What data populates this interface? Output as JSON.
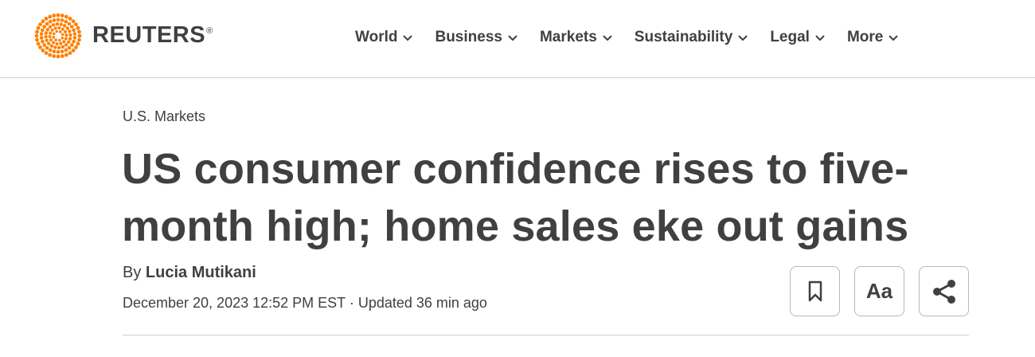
{
  "brand": {
    "name": "REUTERS",
    "registered": "®",
    "accent_color": "#ff8000"
  },
  "nav": {
    "items": [
      {
        "label": "World"
      },
      {
        "label": "Business"
      },
      {
        "label": "Markets"
      },
      {
        "label": "Sustainability"
      },
      {
        "label": "Legal"
      },
      {
        "label": "More"
      }
    ]
  },
  "article": {
    "category": "U.S. Markets",
    "headline_line1": "US consumer confidence rises to five-",
    "headline_line2": "month high; home sales eke out gains",
    "by_prefix": "By",
    "author": "Lucia Mutikani",
    "dateline": "December 20, 2023 12:52 PM EST · Updated 36 min ago"
  },
  "tools": {
    "bookmark_icon": "bookmark-icon",
    "text_size_label": "Aa",
    "share_icon": "share-icon"
  }
}
